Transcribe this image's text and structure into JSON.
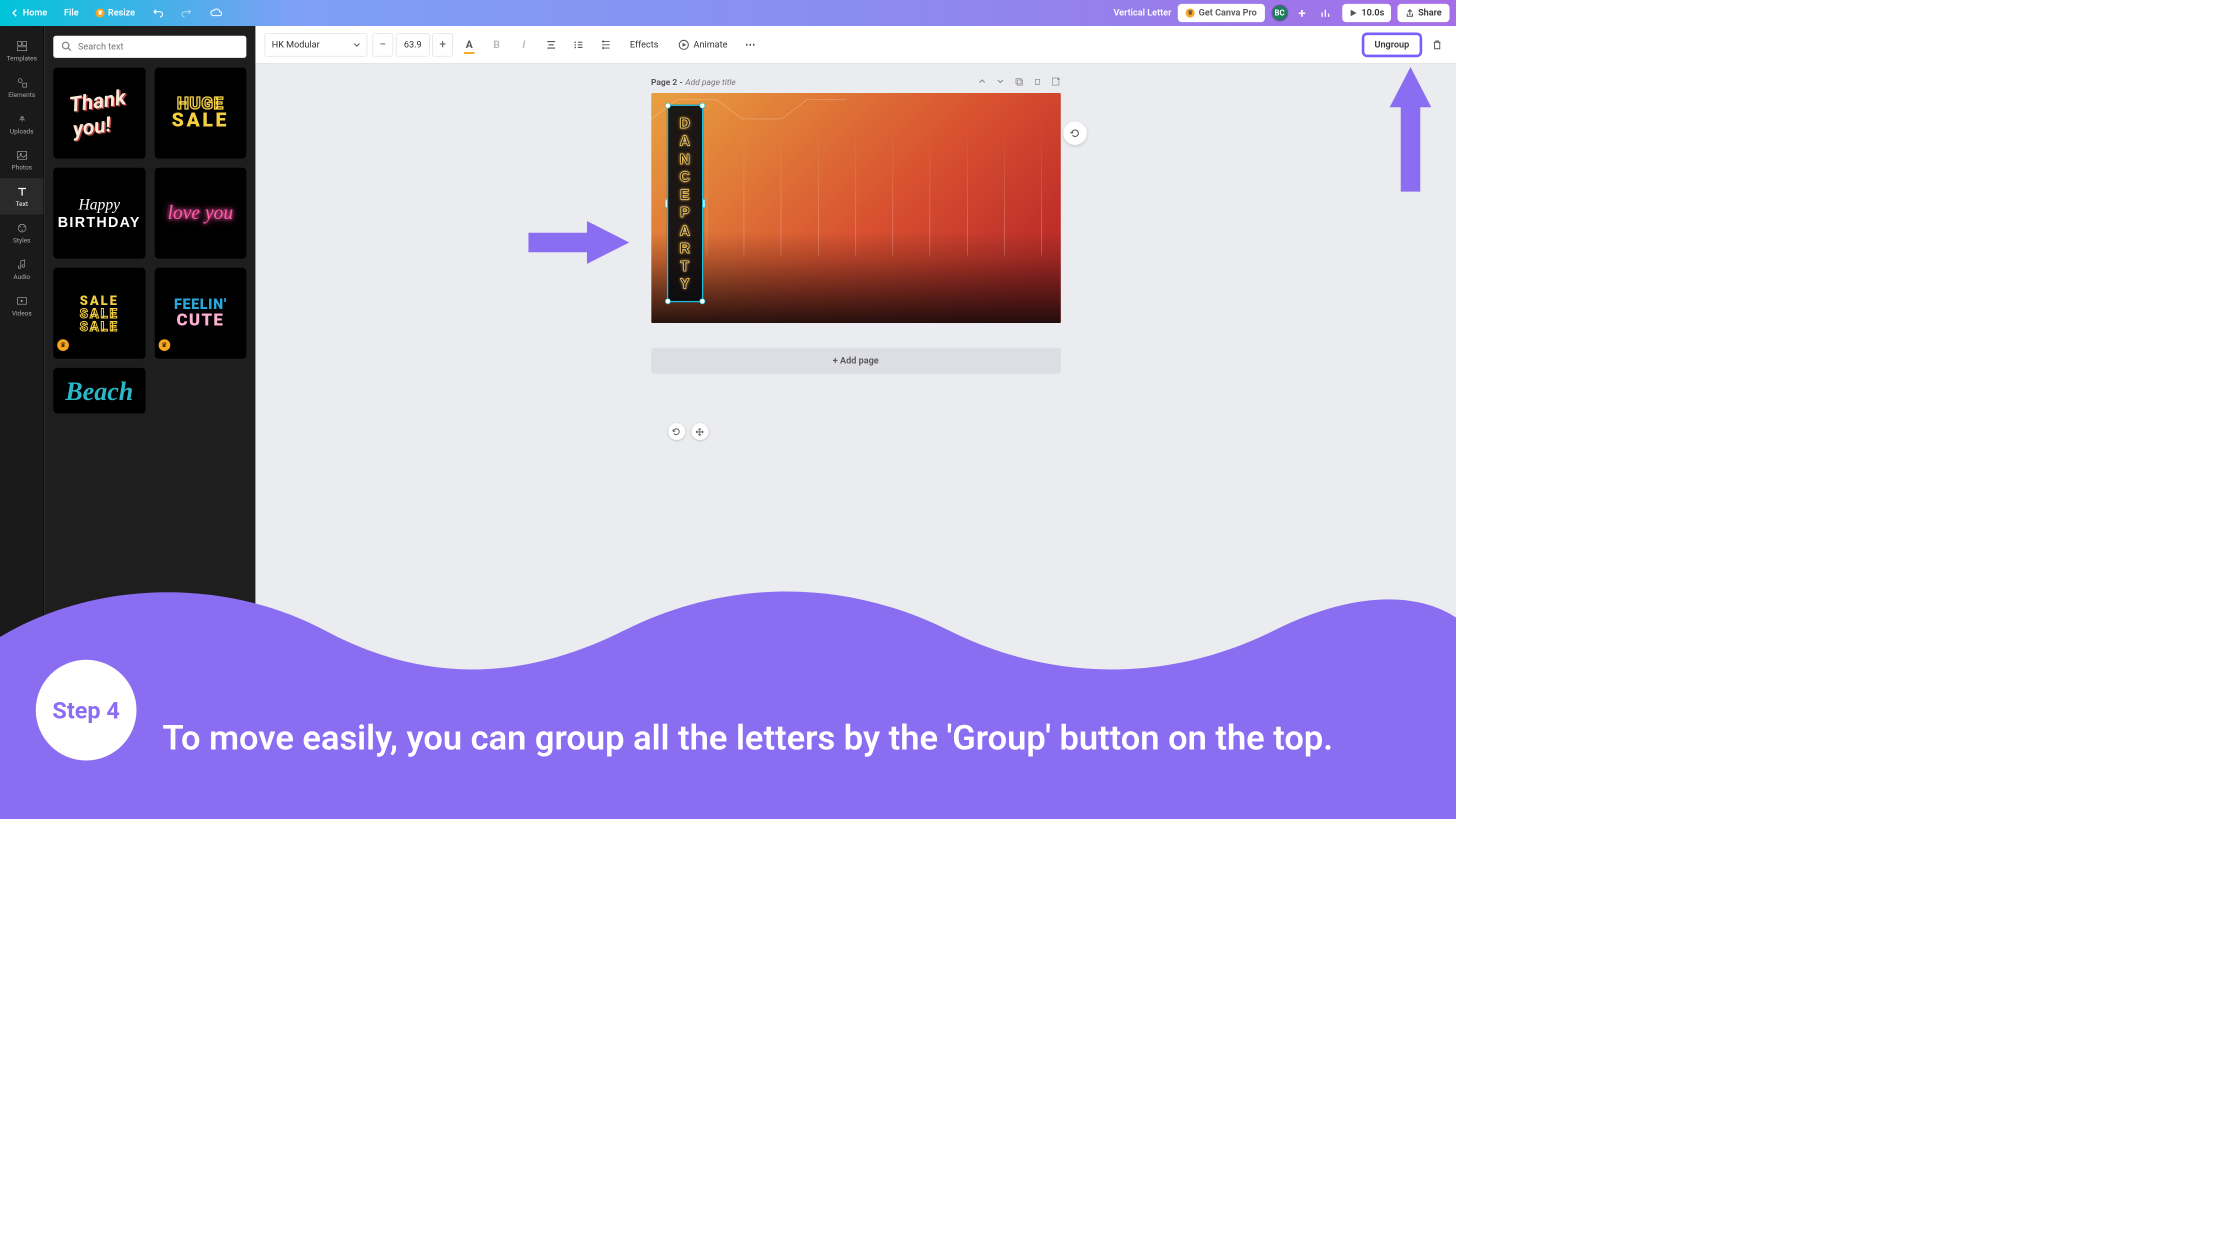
{
  "topbar": {
    "home": "Home",
    "file": "File",
    "resize": "Resize",
    "design_name": "Vertical Letter",
    "get_pro": "Get Canva Pro",
    "avatar": "BC",
    "play_time": "10.0s",
    "share": "Share"
  },
  "nav": {
    "templates": "Templates",
    "elements": "Elements",
    "uploads": "Uploads",
    "photos": "Photos",
    "text": "Text",
    "styles": "Styles",
    "audio": "Audio",
    "videos": "Videos"
  },
  "search": {
    "placeholder": "Search text"
  },
  "thumbs": {
    "thank": {
      "l1": "Thank",
      "l2": "you!"
    },
    "huge": {
      "l1": "HUGE",
      "l2": "SALE"
    },
    "bday": {
      "l1": "Happy",
      "l2": "BIRTHDAY"
    },
    "love": "love you",
    "sale": "SALE",
    "feelin": {
      "l1": "FEELIN'",
      "l2": "CUTE"
    },
    "beach": "Beach"
  },
  "toolbar": {
    "font": "HK Modular",
    "size": "63.9",
    "effects": "Effects",
    "animate": "Animate",
    "ungroup": "Ungroup"
  },
  "page": {
    "label": "Page 2 - ",
    "title_placeholder": "Add page title",
    "add_page": "+ Add page"
  },
  "dance": [
    "D",
    "A",
    "N",
    "C",
    "E",
    "P",
    "A",
    "R",
    "T",
    "Y"
  ],
  "tutorial": {
    "step": "Step 4",
    "text": "To move easily, you can group all the letters by the 'Group' button on the top."
  }
}
